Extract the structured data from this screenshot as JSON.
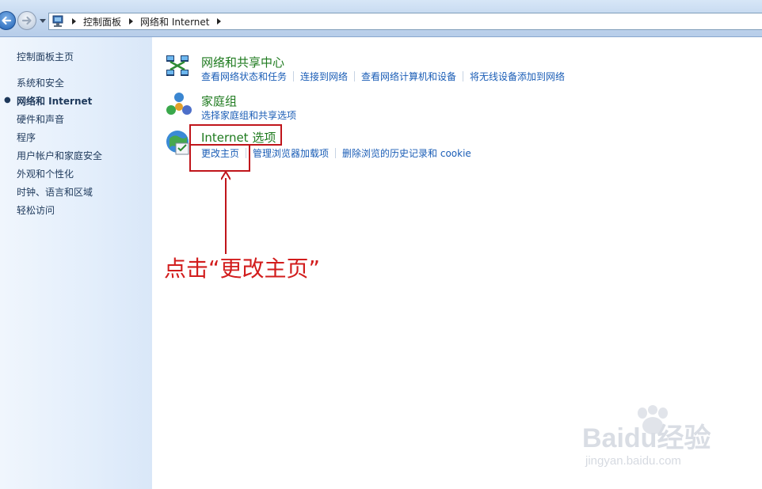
{
  "navigation": {
    "breadcrumb": [
      "控制面板",
      "网络和 Internet"
    ]
  },
  "sidebar": {
    "home": "控制面板主页",
    "items": [
      {
        "label": "系统和安全",
        "current": false
      },
      {
        "label": "网络和 Internet",
        "current": true
      },
      {
        "label": "硬件和声音",
        "current": false
      },
      {
        "label": "程序",
        "current": false
      },
      {
        "label": "用户帐户和家庭安全",
        "current": false
      },
      {
        "label": "外观和个性化",
        "current": false
      },
      {
        "label": "时钟、语言和区域",
        "current": false
      },
      {
        "label": "轻松访问",
        "current": false
      }
    ]
  },
  "main": {
    "categories": [
      {
        "title": "网络和共享中心",
        "icon": "network-sharing-center-icon",
        "links": [
          "查看网络状态和任务",
          "连接到网络",
          "查看网络计算机和设备",
          "将无线设备添加到网络"
        ]
      },
      {
        "title": "家庭组",
        "icon": "homegroup-icon",
        "links": [
          "选择家庭组和共享选项"
        ]
      },
      {
        "title": "Internet 选项",
        "icon": "internet-options-icon",
        "links": [
          "更改主页",
          "管理浏览器加载项",
          "删除浏览的历史记录和 cookie"
        ]
      }
    ]
  },
  "annotation": {
    "text": "点击“更改主页”",
    "color": "#d21d1d"
  },
  "watermark": {
    "logo_text": "Baidu经验",
    "url_text": "jingyan.baidu.com"
  },
  "colors": {
    "category_title": "#1e7a1e",
    "link": "#1a5db6",
    "sidebar_text": "#1e395b",
    "highlight": "#c0151b"
  }
}
